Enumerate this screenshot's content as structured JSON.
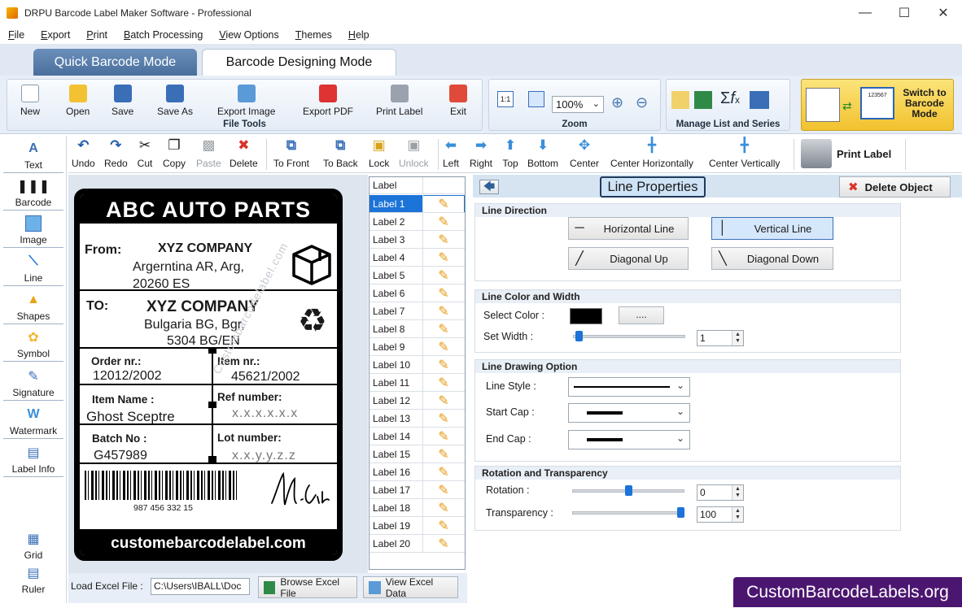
{
  "window": {
    "title": "DRPU Barcode Label Maker Software - Professional"
  },
  "menu": [
    "File",
    "Export",
    "Print",
    "Batch Processing",
    "View Options",
    "Themes",
    "Help"
  ],
  "modes": {
    "quick": "Quick Barcode Mode",
    "designing": "Barcode Designing Mode"
  },
  "file_tools": {
    "group_label": "File Tools",
    "buttons": [
      "New",
      "Open",
      "Save",
      "Save As",
      "Export Image",
      "Export PDF",
      "Print Label",
      "Exit"
    ]
  },
  "zoom": {
    "group_label": "Zoom",
    "value": "100%"
  },
  "manage": {
    "group_label": "Manage List and Series"
  },
  "switch_button": "Switch to Barcode Mode",
  "switch_lines": [
    "Switch to",
    "Barcode",
    "Mode"
  ],
  "switch_sample": "123567",
  "toolbar": {
    "buttons": [
      "Undo",
      "Redo",
      "Cut",
      "Copy",
      "Paste",
      "Delete",
      "To Front",
      "To Back",
      "Lock",
      "Unlock",
      "Left",
      "Right",
      "Top",
      "Bottom",
      "Center",
      "Center Horizontally",
      "Center Vertically"
    ],
    "print_label": "Print Label"
  },
  "tools": [
    "Text",
    "Barcode",
    "Image",
    "Line",
    "Shapes",
    "Symbol",
    "Signature",
    "Watermark",
    "Label Info",
    "Grid",
    "Ruler"
  ],
  "label_card": {
    "header": "ABC AUTO PARTS",
    "from_label": "From:",
    "from_company": "XYZ COMPANY",
    "from_addr1": "Argerntina AR, Arg,",
    "from_addr2": "20260 ES",
    "to_label": "TO:",
    "to_company": "XYZ COMPANY",
    "to_addr1": "Bulgaria BG, Bgr,",
    "to_addr2": "5304 BG/EN",
    "order_label": "Order nr.:",
    "order_value": "12012/2002",
    "item_label": "Item nr.:",
    "item_value": "45621/2002",
    "item_name_label": "Item Name :",
    "item_name_value": "Ghost Sceptre",
    "ref_label": "Ref number:",
    "ref_value": "x.x.x.x.x.x",
    "batch_label": "Batch No :",
    "batch_value": "G457989",
    "lot_label": "Lot number:",
    "lot_value": "x.x.y.y.z.z",
    "barcode_text": "987 456 332 15",
    "footer": "customebarcodelabel.com",
    "watermark": "Custombarcodelabel.com"
  },
  "label_list": {
    "header": "Label",
    "selected": "Label 1",
    "items": [
      "Label 1",
      "Label 2",
      "Label 3",
      "Label 4",
      "Label 5",
      "Label 6",
      "Label 7",
      "Label 8",
      "Label 9",
      "Label 10",
      "Label 11",
      "Label 12",
      "Label 13",
      "Label 14",
      "Label 15",
      "Label 16",
      "Label 17",
      "Label 18",
      "Label 19",
      "Label 20"
    ]
  },
  "properties": {
    "title": "Line Properties",
    "delete_button": "Delete Object",
    "direction": {
      "title": "Line Direction",
      "horizontal": "Horizontal Line",
      "vertical": "Vertical Line",
      "diag_up": "Diagonal Up",
      "diag_down": "Diagonal Down",
      "selected": "Vertical Line"
    },
    "color_width": {
      "title": "Line Color and Width",
      "select_color": "Select Color :",
      "color": "#000000",
      "browse": "....",
      "set_width": "Set Width :",
      "width": "1",
      "width_level": 0.02
    },
    "drawing": {
      "title": "Line Drawing Option",
      "style": "Line Style :",
      "start_cap": "Start Cap :",
      "end_cap": "End Cap :"
    },
    "rotation": {
      "title": "Rotation and Transparency",
      "rotation_label": "Rotation :",
      "rotation_value": "0",
      "rotation_level": 0.5,
      "transparency_label": "Transparency :",
      "transparency_value": "100",
      "transparency_level": 1.0
    }
  },
  "bottom": {
    "load_label": "Load Excel File :",
    "path": "C:\\Users\\IBALL\\Doc",
    "browse": "Browse Excel File",
    "view": "View Excel Data"
  },
  "brand": "CustomBarcodeLabels.org"
}
